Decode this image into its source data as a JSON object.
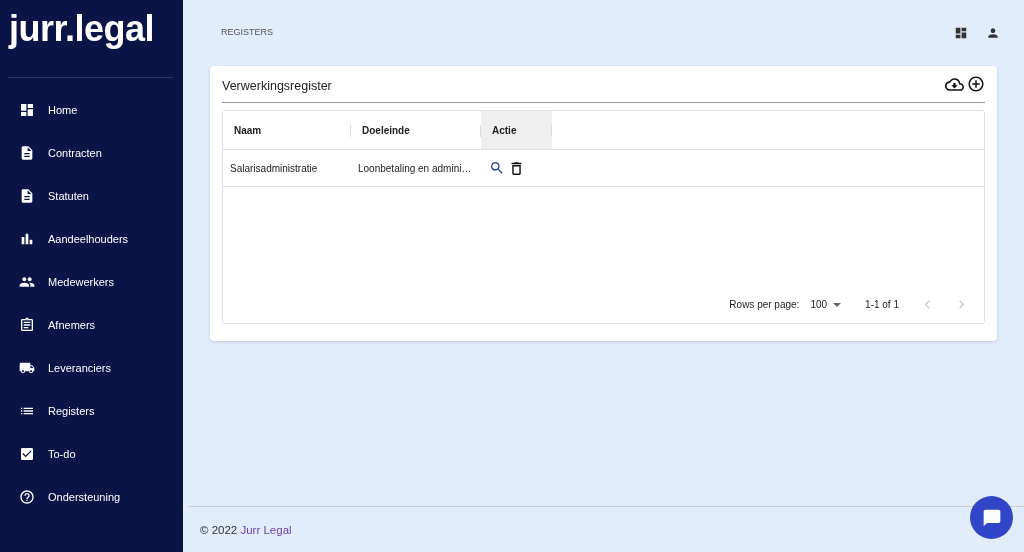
{
  "sidebar": {
    "logo": "jurr.legal",
    "items": [
      {
        "label": "Home"
      },
      {
        "label": "Contracten"
      },
      {
        "label": "Statuten"
      },
      {
        "label": "Aandeelhouders"
      },
      {
        "label": "Medewerkers"
      },
      {
        "label": "Afnemers"
      },
      {
        "label": "Leveranciers"
      },
      {
        "label": "Registers"
      },
      {
        "label": "To-do"
      },
      {
        "label": "Ondersteuning"
      }
    ]
  },
  "breadcrumb": "REGISTERS",
  "card": {
    "title": "Verwerkingsregister",
    "table": {
      "columns": [
        {
          "label": "Naam",
          "highlighted": false
        },
        {
          "label": "Doeleinde",
          "highlighted": false
        },
        {
          "label": "Actie",
          "highlighted": true
        }
      ],
      "rows": [
        {
          "cells": [
            "Salarisadministratie",
            "Loonbetaling en admini…"
          ]
        }
      ]
    },
    "pagination": {
      "rows_label": "Rows per page:",
      "rows_value": "100",
      "range": "1-1 of 1",
      "prev_disabled": true,
      "next_disabled": true
    }
  },
  "footer": {
    "text": "© 2022 ",
    "link": "Jurr Legal"
  }
}
